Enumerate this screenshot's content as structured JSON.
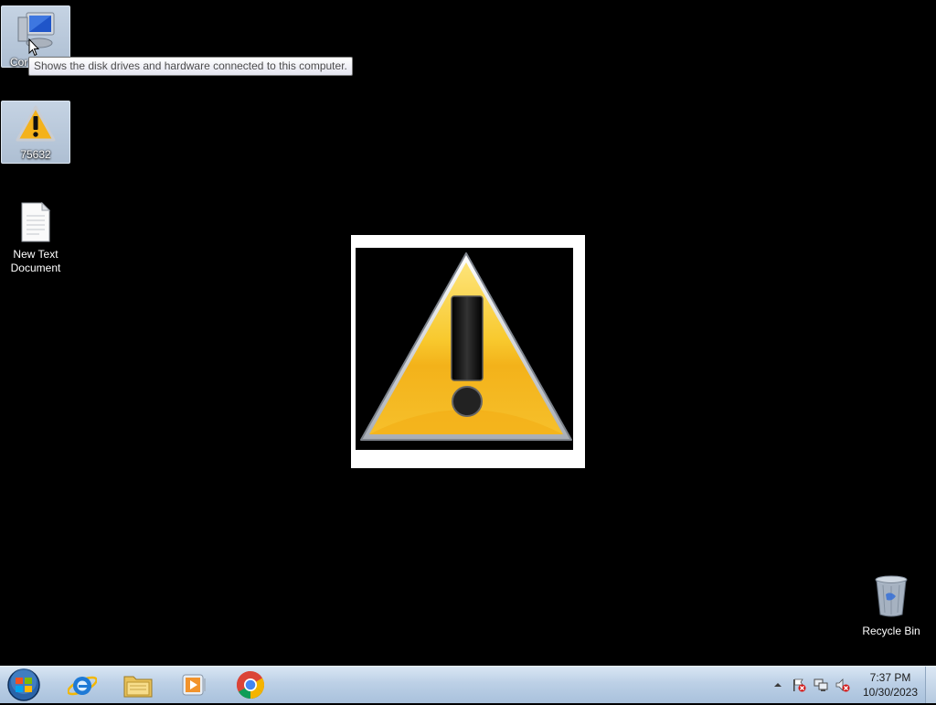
{
  "desktop": {
    "icons": [
      {
        "label": "Cor",
        "icon": "computer-icon"
      },
      {
        "label": "75632",
        "icon": "warning-icon"
      },
      {
        "label": "New Text Document",
        "icon": "text-document-icon"
      },
      {
        "label": "Recycle Bin",
        "icon": "recycle-bin-icon"
      }
    ],
    "tooltip": "Shows the disk drives and hardware connected to this computer."
  },
  "taskbar": {
    "apps": [
      "start-orb-icon",
      "internet-explorer-icon",
      "file-explorer-icon",
      "media-player-icon",
      "chrome-icon"
    ],
    "tray_icons": [
      "show-hidden-icons-arrow",
      "action-center-flag-icon",
      "network-icon",
      "volume-muted-icon"
    ],
    "time": "7:37 PM",
    "date": "10/30/2023"
  },
  "colors": {
    "desktop_bg": "#000000",
    "taskbar": "#bcd0e6",
    "warning_yellow": "#f6b81c"
  }
}
